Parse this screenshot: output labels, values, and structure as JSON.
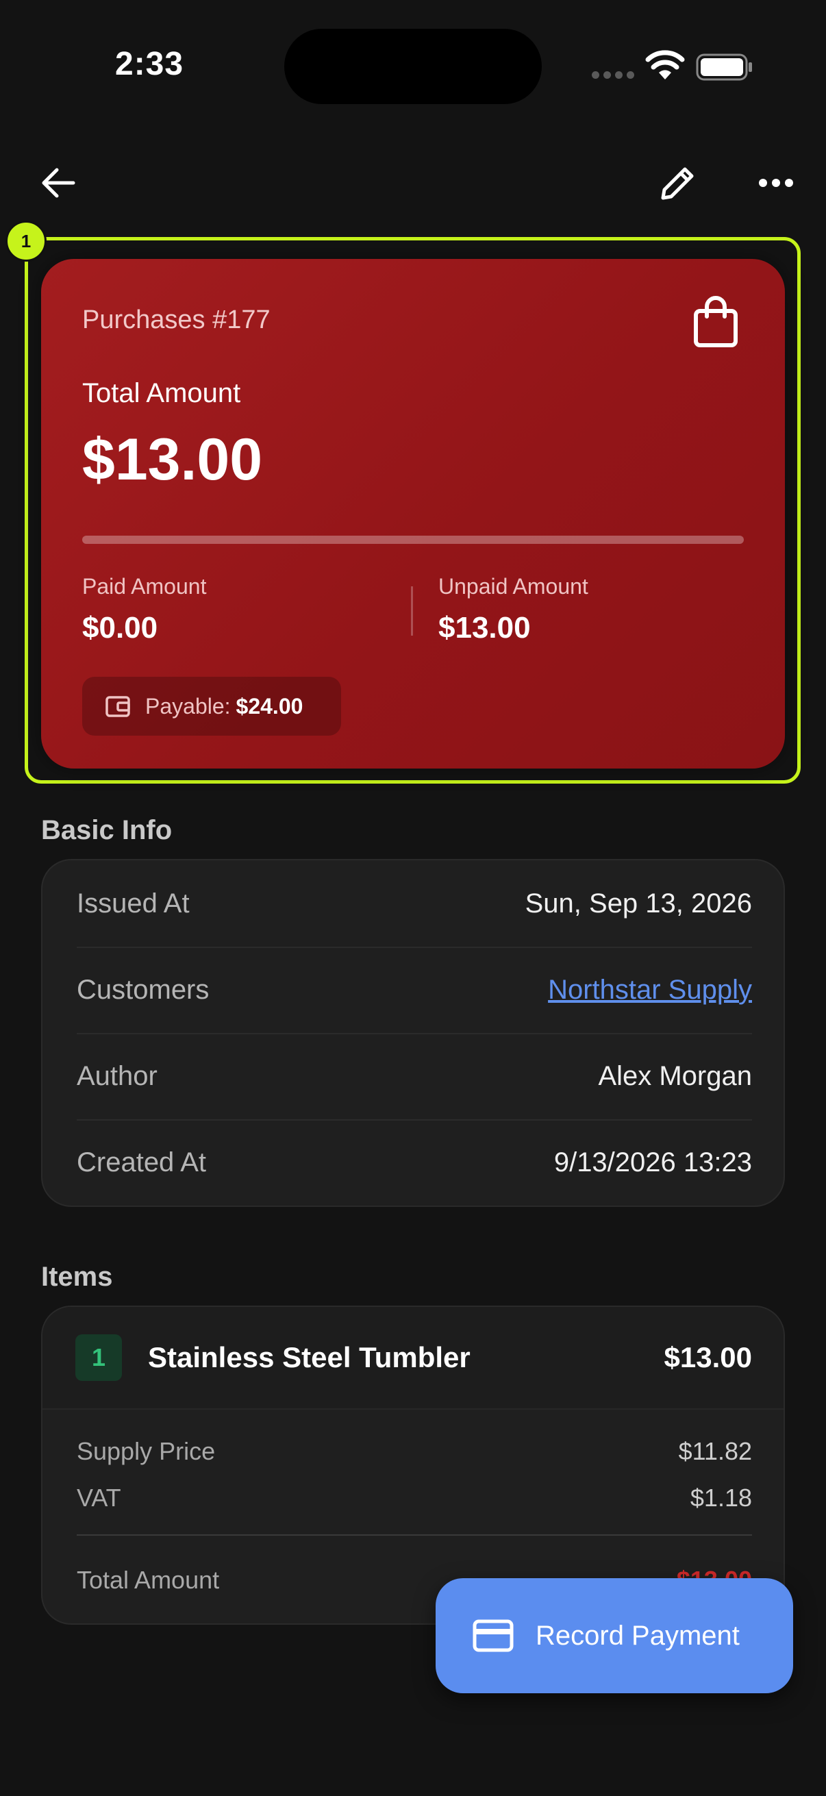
{
  "status_bar": {
    "time": "2:33"
  },
  "summary": {
    "title": "Purchases #177",
    "total_label": "Total Amount",
    "total_value": "$13.00",
    "paid_fraction": 0,
    "paid_label": "Paid Amount",
    "paid_value": "$0.00",
    "unpaid_label": "Unpaid Amount",
    "unpaid_value": "$13.00",
    "payable_label": "Payable:",
    "payable_value": "$24.00"
  },
  "annotation": {
    "badge": "1",
    "color": "#c6f31b"
  },
  "basic_info": {
    "heading": "Basic Info",
    "rows": [
      {
        "key": "Issued At",
        "value": "Sun, Sep 13, 2026"
      },
      {
        "key": "Customers",
        "value": "Northstar Supply"
      },
      {
        "key": "Author",
        "value": "Alex Morgan"
      },
      {
        "key": "Created At",
        "value": "9/13/2026 13:23"
      }
    ]
  },
  "items": {
    "heading": "Items",
    "list": [
      {
        "index": "1",
        "name": "Stainless Steel Tumbler",
        "price": "$13.00",
        "supply_label": "Supply Price",
        "supply_value": "$11.82",
        "vat_label": "VAT",
        "vat_value": "$1.18",
        "total_label": "Total Amount",
        "total_value": "$13.00"
      }
    ]
  },
  "fab": {
    "label": "Record Payment"
  },
  "colors": {
    "card_red": "#9a1719",
    "link_blue": "#5f8fec",
    "fab_blue": "#5b8def",
    "item_green": "#33c27a",
    "total_red": "#d12a2a"
  }
}
